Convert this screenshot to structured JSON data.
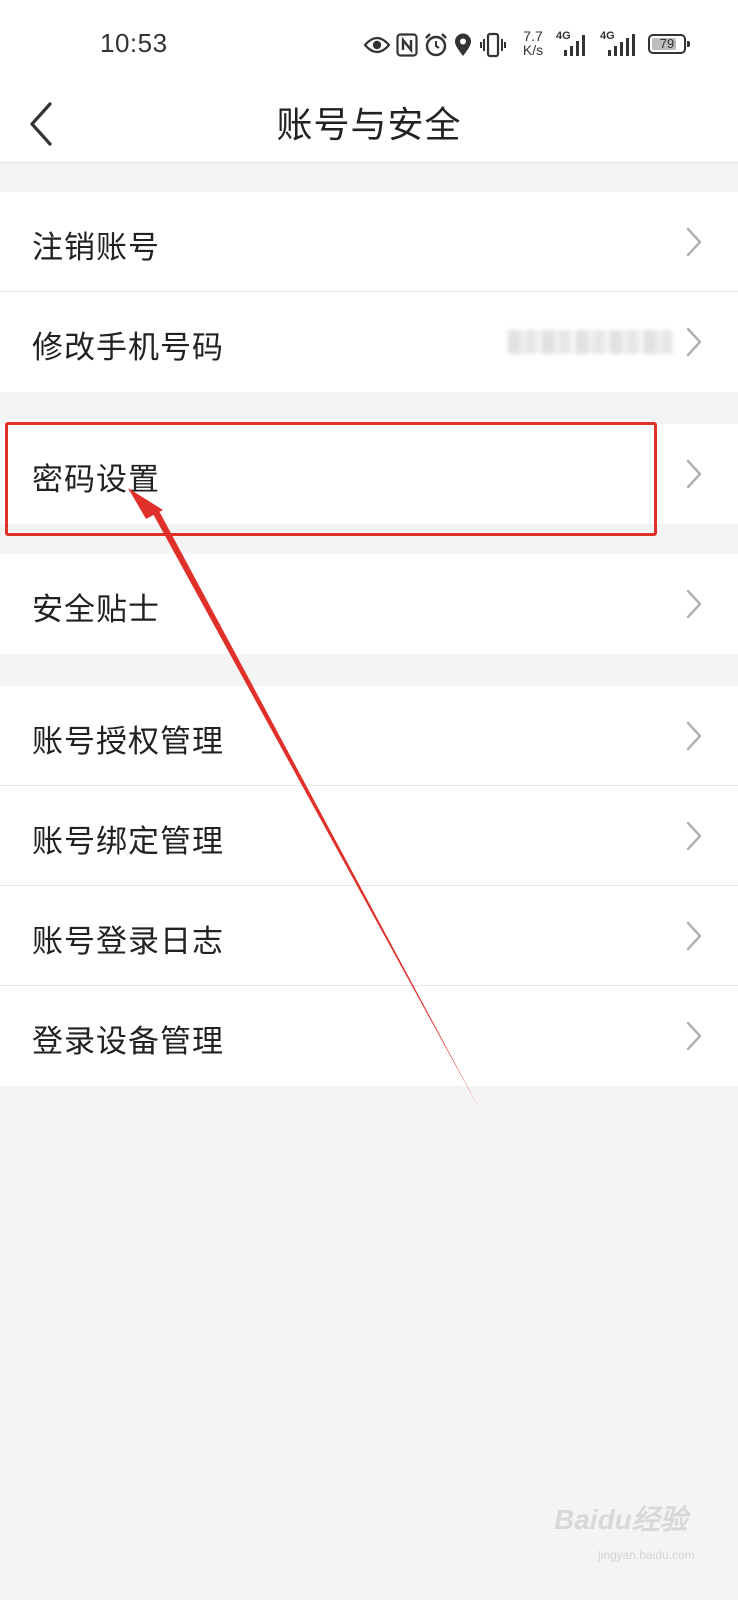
{
  "status_bar": {
    "time": "10:53",
    "net_speed_top": "7.7",
    "net_speed_bottom": "K/s",
    "signal_1": "4G",
    "signal_2": "4G",
    "battery": "79",
    "icons": [
      "eye-icon",
      "nfc-icon",
      "alarm-icon",
      "location-icon",
      "vibrate-icon",
      "signal-icon",
      "signal-icon",
      "battery-icon"
    ]
  },
  "header": {
    "title": "账号与安全",
    "back_icon": "chevron-left-icon"
  },
  "groups": [
    {
      "items": [
        {
          "label": "注销账号"
        },
        {
          "label": "修改手机号码"
        }
      ]
    },
    {
      "items": [
        {
          "label": "密码设置"
        }
      ]
    },
    {
      "items": [
        {
          "label": "安全贴士"
        }
      ]
    },
    {
      "items": [
        {
          "label": "账号授权管理"
        },
        {
          "label": "账号绑定管理"
        },
        {
          "label": "账号登录日志"
        },
        {
          "label": "登录设备管理"
        }
      ]
    }
  ],
  "annotation": {
    "highlighted_item": "密码设置",
    "color": "#e0302a"
  },
  "watermark": {
    "text": "Baidu经验",
    "sub": "jingyan.baidu.com"
  },
  "colors": {
    "page_bg": "#f4f4f4",
    "card_bg": "#ffffff",
    "divider": "#e7e7e7",
    "text": "#222222",
    "chevron": "#b0b0b0"
  }
}
